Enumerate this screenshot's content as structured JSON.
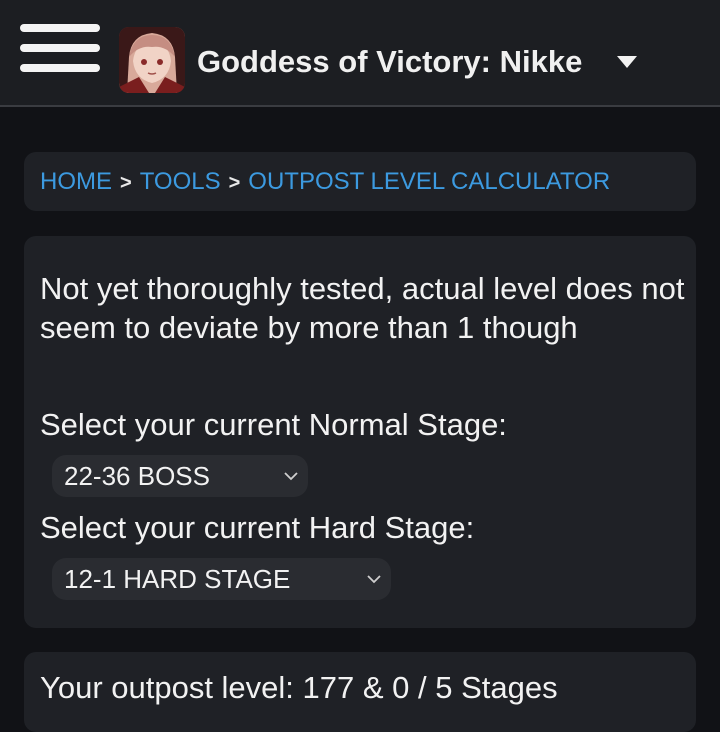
{
  "header": {
    "title": "Goddess of Victory: Nikke",
    "menu_icon": "hamburger-menu-icon",
    "caret_icon": "caret-down-icon",
    "avatar": "game-avatar"
  },
  "breadcrumb": {
    "home": "HOME",
    "tools": "TOOLS",
    "current": "OUTPOST LEVEL CALCULATOR",
    "separator": ">"
  },
  "main": {
    "note": "Not yet thoroughly tested, actual level does not seem to deviate by more than 1 though",
    "normal_label": "Select your current Normal Stage:",
    "normal_value": "22-36 BOSS",
    "hard_label": "Select your current Hard Stage:",
    "hard_value": "12-1 HARD STAGE"
  },
  "result": {
    "text": "Your outpost level: 177 & 0 / 5 Stages"
  },
  "colors": {
    "background": "#111216",
    "card": "#1f2126",
    "link": "#3c9ae0",
    "select": "#2a2c31"
  }
}
